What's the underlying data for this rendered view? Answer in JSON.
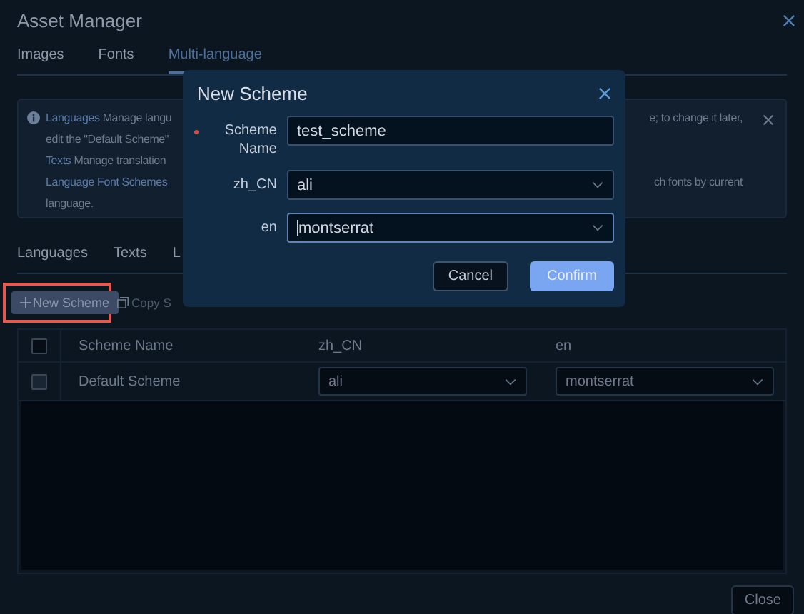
{
  "window": {
    "title": "Asset Manager"
  },
  "tabs": [
    {
      "label": "Images",
      "selected": false
    },
    {
      "label": "Fonts",
      "selected": false
    },
    {
      "label": "Multi-language",
      "selected": true
    }
  ],
  "info": {
    "lines": [
      {
        "left": "**Languages** Manage langu",
        "right": "e; to change it later,"
      },
      {
        "left": "edit the \"Default Scheme\""
      },
      {
        "left": "**Texts** Manage translation"
      },
      {
        "left": "**Language Font Schemes**",
        "right": "ch fonts by current"
      },
      {
        "left": "language."
      }
    ]
  },
  "subtabs": [
    {
      "label": "Languages"
    },
    {
      "label": "Texts"
    },
    {
      "label": "L"
    }
  ],
  "toolbar": {
    "new_button": {
      "label": "New Scheme",
      "highlighted": true
    },
    "copy_button": {
      "label": "Copy S",
      "disabled": true
    }
  },
  "table": {
    "all_checked": false,
    "columns": [
      "Scheme Name",
      "zh_CN",
      "en"
    ],
    "rows": [
      {
        "checked": false,
        "name": "Default Scheme",
        "zh_CN": "ali",
        "en": "montserrat"
      }
    ]
  },
  "close_button": "Close",
  "modal": {
    "title": "New Scheme",
    "fields": [
      {
        "label": "Scheme Name",
        "kind": "text",
        "required": true,
        "value": "test_scheme",
        "focused": false
      },
      {
        "label": "zh_CN",
        "kind": "select",
        "required": false,
        "value": "ali",
        "focused": false
      },
      {
        "label": "en",
        "kind": "select",
        "required": false,
        "value": "montserrat",
        "focused": true
      }
    ],
    "buttons": [
      {
        "label": "Cancel",
        "kind": "secondary"
      },
      {
        "label": "Confirm",
        "kind": "primary"
      }
    ]
  }
}
